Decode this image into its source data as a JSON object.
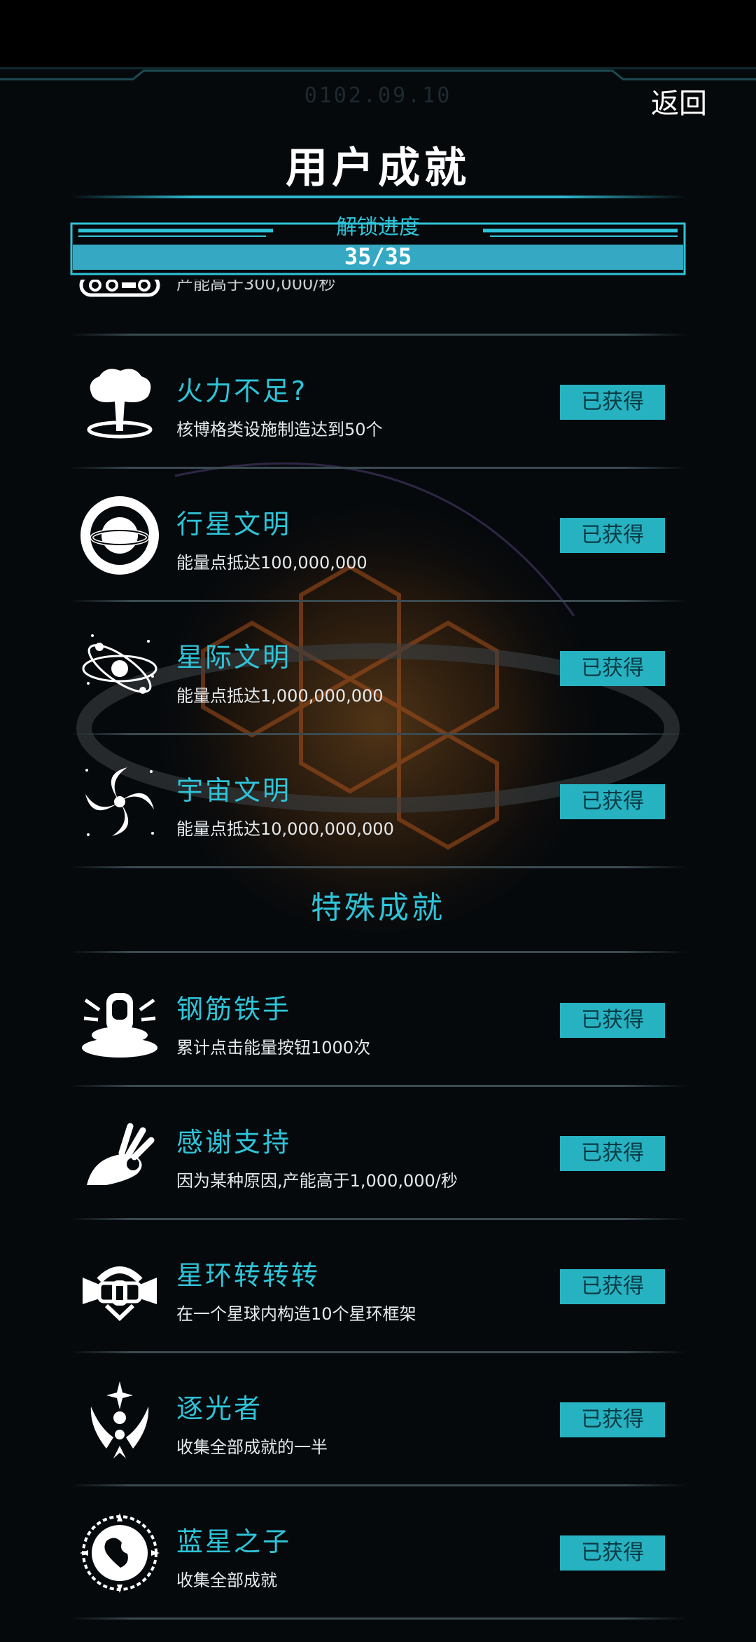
{
  "header": {
    "date": "0102.09.10",
    "back_label": "返回",
    "title": "用户成就"
  },
  "progress": {
    "label": "解锁进度",
    "text": "35/35",
    "value": 1.0
  },
  "partial_row": {
    "desc": "产能高于300,000/秒"
  },
  "achievements": [
    {
      "name": "火力不足?",
      "desc": "核博格类设施制造达到50个",
      "status": "已获得",
      "icon": "mushroom-cloud-icon"
    },
    {
      "name": "行星文明",
      "desc": "能量点抵达100,000,000",
      "status": "已获得",
      "icon": "ringed-planet-icon"
    },
    {
      "name": "星际文明",
      "desc": "能量点抵达1,000,000,000",
      "status": "已获得",
      "icon": "orbit-atom-icon"
    },
    {
      "name": "宇宙文明",
      "desc": "能量点抵达10,000,000,000",
      "status": "已获得",
      "icon": "galaxy-swirl-icon"
    }
  ],
  "special_section": {
    "title": "特殊成就",
    "items": [
      {
        "name": "钢筋铁手",
        "desc": "累计点击能量按钮1000次",
        "status": "已获得",
        "icon": "press-button-icon"
      },
      {
        "name": "感谢支持",
        "desc": "因为某种原因,产能高于1,000,000/秒",
        "status": "已获得",
        "icon": "ok-hand-icon"
      },
      {
        "name": "星环转转转",
        "desc": "在一个星球内构造10个星环框架",
        "status": "已获得",
        "icon": "ring-frame-icon"
      },
      {
        "name": "逐光者",
        "desc": "收集全部成就的一半",
        "status": "已获得",
        "icon": "winged-star-icon"
      },
      {
        "name": "蓝星之子",
        "desc": "收集全部成就",
        "status": "已获得",
        "icon": "blue-planet-emblem-icon"
      }
    ]
  },
  "colors": {
    "accent": "#2fc4d8",
    "badge_bg": "#27b2c2",
    "badge_text": "#0a3b44",
    "background": "#06090c"
  }
}
